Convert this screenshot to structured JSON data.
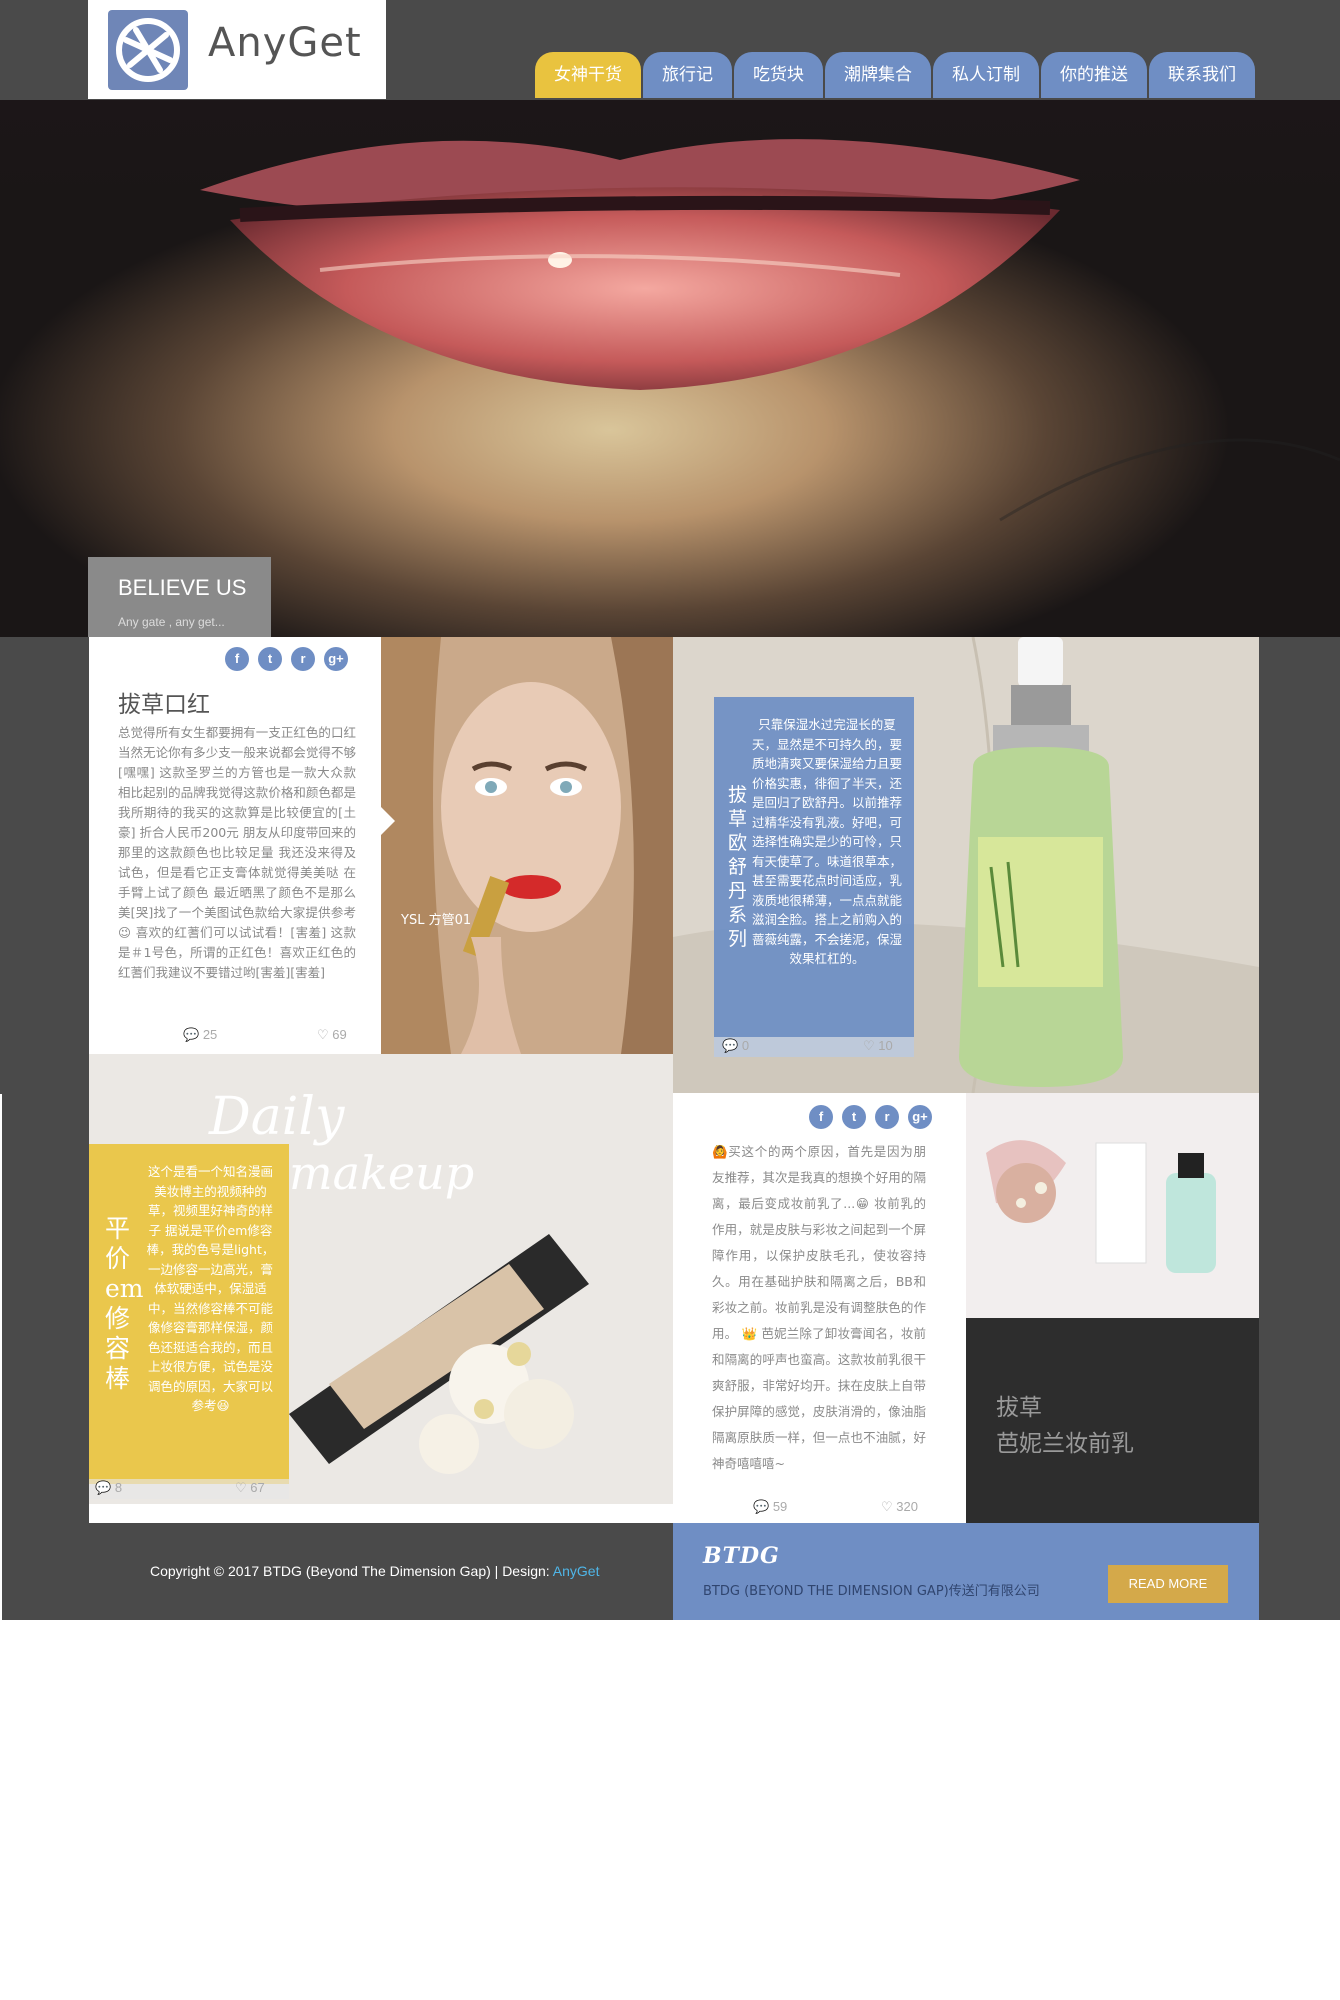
{
  "brand": {
    "logo_text": "AnyGet"
  },
  "nav": {
    "items": [
      {
        "label": "女神干货",
        "active": true
      },
      {
        "label": "旅行记",
        "active": false
      },
      {
        "label": "吃货块",
        "active": false
      },
      {
        "label": "潮牌集合",
        "active": false
      },
      {
        "label": "私人订制",
        "active": false
      },
      {
        "label": "你的推送",
        "active": false
      },
      {
        "label": "联系我们",
        "active": false
      }
    ]
  },
  "hero": {
    "title": "BELIEVE US",
    "subtitle": "Any gate , any get..."
  },
  "social_icons": [
    {
      "icon": "facebook-icon",
      "glyph": "f"
    },
    {
      "icon": "twitter-icon",
      "glyph": "t"
    },
    {
      "icon": "rss-icon",
      "glyph": "r"
    },
    {
      "icon": "google-plus-icon",
      "glyph": "g+"
    }
  ],
  "posts": {
    "lipstick": {
      "title": "拔草口红",
      "body": "总觉得所有女生都要拥有一支正红色的口红 当然无论你有多少支一般来说都会觉得不够[嘿嘿] 这款圣罗兰的方管也是一款大众款 相比起别的品牌我觉得这款价格和颜色都是我所期待的我买的这款算是比较便宜的[土豪] 折合人民币200元 朋友从印度带回来的那里的这款颜色也比较足量 我还没来得及试色，但是看它正支膏体就觉得美美哒 在手臂上试了颜色 最近晒黑了颜色不是那么美[哭]找了一个美图试色款给大家提供参考😉 喜欢的红蓍们可以试试看！[害羞] 这款是＃1号色，所谓的正红色！喜欢正红色的红蓍们我建议不要错过哟[害羞][害羞]",
      "image_caption": "YSL 方管01",
      "comments": "25",
      "likes": "69"
    },
    "loccitane": {
      "vertical_title": "拔草欧舒丹系列",
      "body": "只靠保湿水过完湿长的夏天，显然是不可持久的，要质地清爽又要保湿给力且要价格实惠，徘徊了半天，还是回归了欧舒丹。以前推荐过精华没有乳液。好吧，可选择性确实是少的可怜，只有天使草了。味道很草本，甚至需要花点时间适应，乳液质地很稀薄，一点点就能滋润全脸。搭上之前购入的蔷薇纯露，不会搓泥，保湿效果杠杠的。",
      "comments": "0",
      "likes": "10"
    },
    "concealer": {
      "vertical_title": "平价em修容棒",
      "body": "这个是看一个知名漫画美妆博主的视频种的草，视频里好神奇的样子 据说是平价em修容棒，我的色号是light，一边修容一边高光，膏体软硬适中，保湿适中，当然修容棒不可能像修容膏那样保湿，颜色还挺适合我的，而且上妆很方便，试色是没调色的原因，大家可以参考😆",
      "comments": "8",
      "likes": "67"
    },
    "primer": {
      "body": "🙆买这个的两个原因，首先是因为朋友推荐，其次是我真的想换个好用的隔离，最后变成妆前乳了...😁 妆前乳的作用，就是皮肤与彩妆之间起到一个屏障作用，以保护皮肤毛孔，使妆容持久。用在基础护肤和隔离之后，BB和彩妆之前。妆前乳是没有调整肤色的作用。 👑 芭妮兰除了卸妆膏闻名，妆前和隔离的呼声也蛮高。这款妆前乳很干爽舒服，非常好均开。抹在皮肤上自带保护屏障的感觉，皮肤消滑的，像油脂隔离原肤质一样，但一点也不油腻，好神奇嘻嘻嘻~",
      "comments": "59",
      "likes": "320",
      "feature_title_line1": "拔草",
      "feature_title_line2": "芭妮兰妆前乳"
    }
  },
  "footer": {
    "copyright": "Copyright © 2017 BTDG (Beyond The Dimension Gap) | Design: ",
    "design_link": "AnyGet",
    "brand": "BTDG",
    "company": "BTDG (BEYOND THE DIMENSION GAP)传送门有限公司",
    "read_more": "READ MORE"
  },
  "colors": {
    "background": "#4a4a4a",
    "nav_blue": "#6f8ec4",
    "nav_active": "#e9c33f",
    "read_more": "#d4a94a",
    "link": "#4fb6e8"
  }
}
